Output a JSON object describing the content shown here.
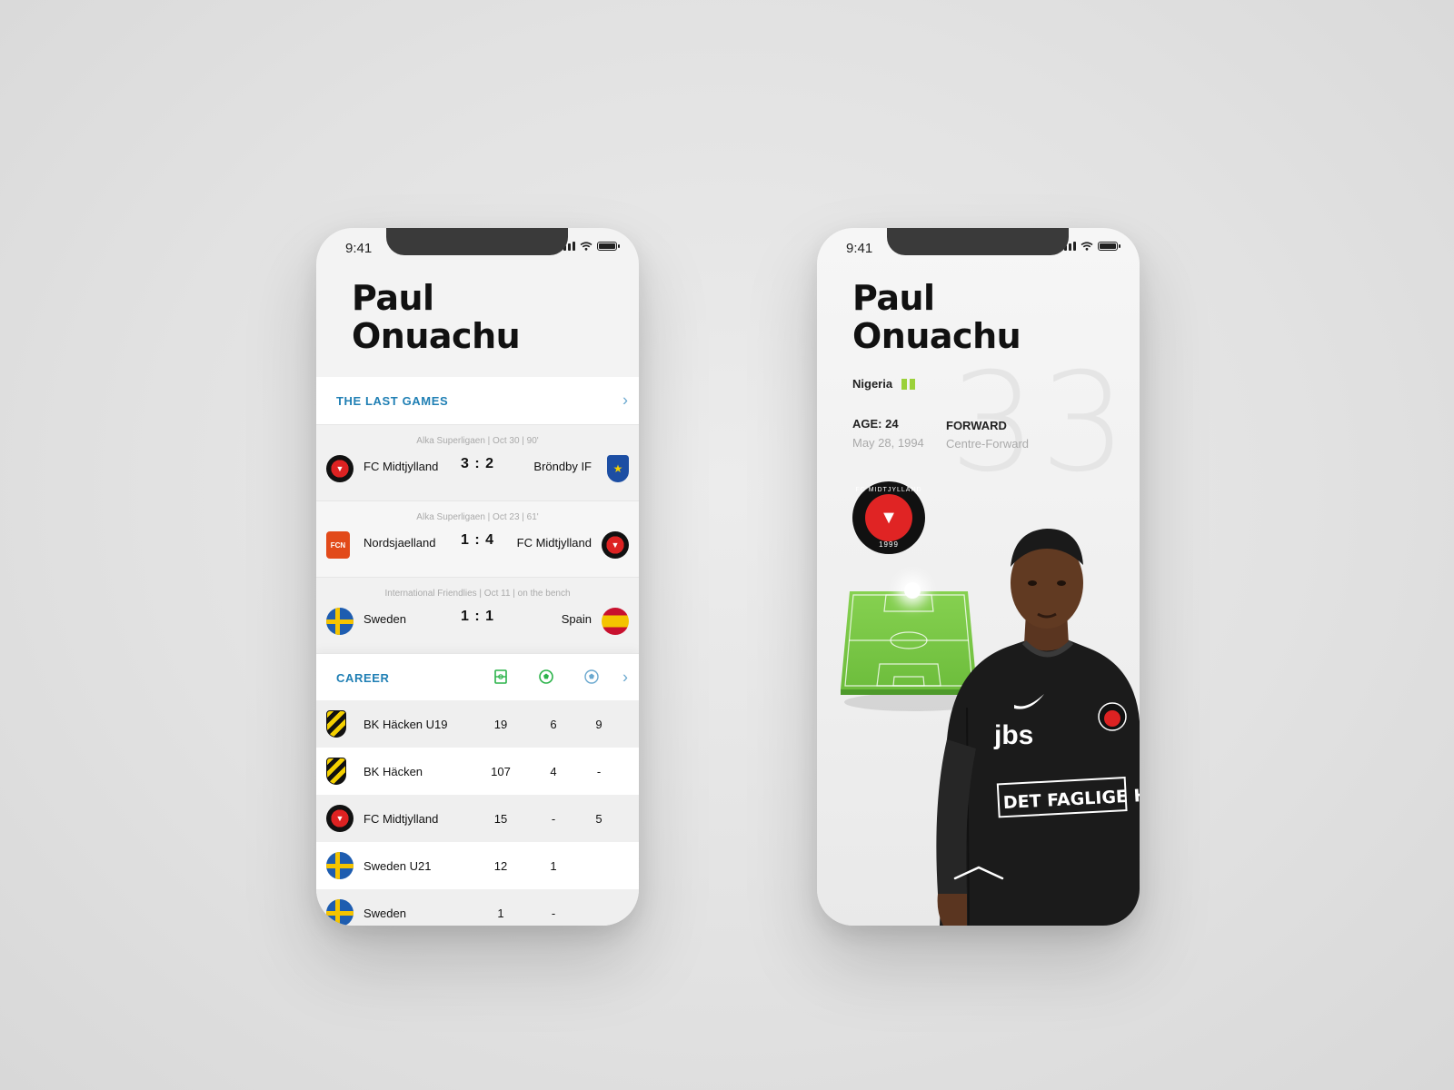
{
  "screens": {
    "left": {
      "status_time": "9:41",
      "player_first": "Paul",
      "player_last": "Onuachu",
      "last_games_title": "THE LAST GAMES",
      "games": [
        {
          "meta": "Alka Superligaen  |  Oct 30  |  90'",
          "home": "FC Midtjylland",
          "score": "3 : 2",
          "away": "Bröndby IF"
        },
        {
          "meta": "Alka Superligaen  |  Oct 23  |  61'",
          "home": "Nordsjaelland",
          "score": "1 : 4",
          "away": "FC Midtjylland"
        },
        {
          "meta": "International Friendlies  |  Oct 11  |  on the bench",
          "home": "Sweden",
          "score": "1 : 1",
          "away": "Spain"
        }
      ],
      "career_title": "CAREER",
      "career": [
        {
          "club": "BK Häcken U19",
          "apps": "19",
          "goals": "6",
          "assists": "9"
        },
        {
          "club": "BK Häcken",
          "apps": "107",
          "goals": "4",
          "assists": "-"
        },
        {
          "club": "FC Midtjylland",
          "apps": "15",
          "goals": "-",
          "assists": "5"
        },
        {
          "club": "Sweden U21",
          "apps": "12",
          "goals": "1",
          "assists": ""
        },
        {
          "club": "Sweden",
          "apps": "1",
          "goals": "-",
          "assists": ""
        }
      ]
    },
    "right": {
      "status_time": "9:41",
      "player_first": "Paul",
      "player_last": "Onuachu",
      "nationality": "Nigeria",
      "age_label": "AGE: 24",
      "birth_date": "May 28, 1994",
      "position": "FORWARD",
      "position_detail": "Centre-Forward",
      "shirt_number": "33",
      "badge_ring": "FC MIDTJYLLAND",
      "badge_year": "1999"
    }
  },
  "colors": {
    "accent": "#1f7fb4",
    "pitch": "#7cc94a",
    "nigeria_green": "#9bd13a",
    "club_red": "#e02424"
  },
  "icons": [
    "apps-icon",
    "goals-icon",
    "assists-icon",
    "chevron-right-icon",
    "wifi-icon",
    "signal-icon",
    "battery-icon"
  ]
}
